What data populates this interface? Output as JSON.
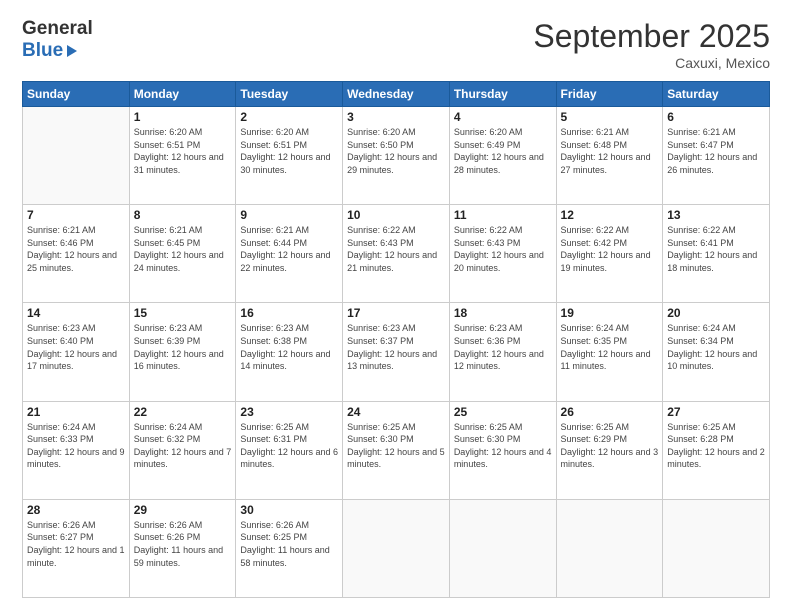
{
  "header": {
    "logo_line1": "General",
    "logo_line2": "Blue",
    "month_title": "September 2025",
    "subtitle": "Caxuxi, Mexico"
  },
  "calendar": {
    "days_of_week": [
      "Sunday",
      "Monday",
      "Tuesday",
      "Wednesday",
      "Thursday",
      "Friday",
      "Saturday"
    ],
    "weeks": [
      [
        {
          "day": "",
          "sunrise": "",
          "sunset": "",
          "daylight": ""
        },
        {
          "day": "1",
          "sunrise": "Sunrise: 6:20 AM",
          "sunset": "Sunset: 6:51 PM",
          "daylight": "Daylight: 12 hours and 31 minutes."
        },
        {
          "day": "2",
          "sunrise": "Sunrise: 6:20 AM",
          "sunset": "Sunset: 6:51 PM",
          "daylight": "Daylight: 12 hours and 30 minutes."
        },
        {
          "day": "3",
          "sunrise": "Sunrise: 6:20 AM",
          "sunset": "Sunset: 6:50 PM",
          "daylight": "Daylight: 12 hours and 29 minutes."
        },
        {
          "day": "4",
          "sunrise": "Sunrise: 6:20 AM",
          "sunset": "Sunset: 6:49 PM",
          "daylight": "Daylight: 12 hours and 28 minutes."
        },
        {
          "day": "5",
          "sunrise": "Sunrise: 6:21 AM",
          "sunset": "Sunset: 6:48 PM",
          "daylight": "Daylight: 12 hours and 27 minutes."
        },
        {
          "day": "6",
          "sunrise": "Sunrise: 6:21 AM",
          "sunset": "Sunset: 6:47 PM",
          "daylight": "Daylight: 12 hours and 26 minutes."
        }
      ],
      [
        {
          "day": "7",
          "sunrise": "Sunrise: 6:21 AM",
          "sunset": "Sunset: 6:46 PM",
          "daylight": "Daylight: 12 hours and 25 minutes."
        },
        {
          "day": "8",
          "sunrise": "Sunrise: 6:21 AM",
          "sunset": "Sunset: 6:45 PM",
          "daylight": "Daylight: 12 hours and 24 minutes."
        },
        {
          "day": "9",
          "sunrise": "Sunrise: 6:21 AM",
          "sunset": "Sunset: 6:44 PM",
          "daylight": "Daylight: 12 hours and 22 minutes."
        },
        {
          "day": "10",
          "sunrise": "Sunrise: 6:22 AM",
          "sunset": "Sunset: 6:43 PM",
          "daylight": "Daylight: 12 hours and 21 minutes."
        },
        {
          "day": "11",
          "sunrise": "Sunrise: 6:22 AM",
          "sunset": "Sunset: 6:43 PM",
          "daylight": "Daylight: 12 hours and 20 minutes."
        },
        {
          "day": "12",
          "sunrise": "Sunrise: 6:22 AM",
          "sunset": "Sunset: 6:42 PM",
          "daylight": "Daylight: 12 hours and 19 minutes."
        },
        {
          "day": "13",
          "sunrise": "Sunrise: 6:22 AM",
          "sunset": "Sunset: 6:41 PM",
          "daylight": "Daylight: 12 hours and 18 minutes."
        }
      ],
      [
        {
          "day": "14",
          "sunrise": "Sunrise: 6:23 AM",
          "sunset": "Sunset: 6:40 PM",
          "daylight": "Daylight: 12 hours and 17 minutes."
        },
        {
          "day": "15",
          "sunrise": "Sunrise: 6:23 AM",
          "sunset": "Sunset: 6:39 PM",
          "daylight": "Daylight: 12 hours and 16 minutes."
        },
        {
          "day": "16",
          "sunrise": "Sunrise: 6:23 AM",
          "sunset": "Sunset: 6:38 PM",
          "daylight": "Daylight: 12 hours and 14 minutes."
        },
        {
          "day": "17",
          "sunrise": "Sunrise: 6:23 AM",
          "sunset": "Sunset: 6:37 PM",
          "daylight": "Daylight: 12 hours and 13 minutes."
        },
        {
          "day": "18",
          "sunrise": "Sunrise: 6:23 AM",
          "sunset": "Sunset: 6:36 PM",
          "daylight": "Daylight: 12 hours and 12 minutes."
        },
        {
          "day": "19",
          "sunrise": "Sunrise: 6:24 AM",
          "sunset": "Sunset: 6:35 PM",
          "daylight": "Daylight: 12 hours and 11 minutes."
        },
        {
          "day": "20",
          "sunrise": "Sunrise: 6:24 AM",
          "sunset": "Sunset: 6:34 PM",
          "daylight": "Daylight: 12 hours and 10 minutes."
        }
      ],
      [
        {
          "day": "21",
          "sunrise": "Sunrise: 6:24 AM",
          "sunset": "Sunset: 6:33 PM",
          "daylight": "Daylight: 12 hours and 9 minutes."
        },
        {
          "day": "22",
          "sunrise": "Sunrise: 6:24 AM",
          "sunset": "Sunset: 6:32 PM",
          "daylight": "Daylight: 12 hours and 7 minutes."
        },
        {
          "day": "23",
          "sunrise": "Sunrise: 6:25 AM",
          "sunset": "Sunset: 6:31 PM",
          "daylight": "Daylight: 12 hours and 6 minutes."
        },
        {
          "day": "24",
          "sunrise": "Sunrise: 6:25 AM",
          "sunset": "Sunset: 6:30 PM",
          "daylight": "Daylight: 12 hours and 5 minutes."
        },
        {
          "day": "25",
          "sunrise": "Sunrise: 6:25 AM",
          "sunset": "Sunset: 6:30 PM",
          "daylight": "Daylight: 12 hours and 4 minutes."
        },
        {
          "day": "26",
          "sunrise": "Sunrise: 6:25 AM",
          "sunset": "Sunset: 6:29 PM",
          "daylight": "Daylight: 12 hours and 3 minutes."
        },
        {
          "day": "27",
          "sunrise": "Sunrise: 6:25 AM",
          "sunset": "Sunset: 6:28 PM",
          "daylight": "Daylight: 12 hours and 2 minutes."
        }
      ],
      [
        {
          "day": "28",
          "sunrise": "Sunrise: 6:26 AM",
          "sunset": "Sunset: 6:27 PM",
          "daylight": "Daylight: 12 hours and 1 minute."
        },
        {
          "day": "29",
          "sunrise": "Sunrise: 6:26 AM",
          "sunset": "Sunset: 6:26 PM",
          "daylight": "Daylight: 11 hours and 59 minutes."
        },
        {
          "day": "30",
          "sunrise": "Sunrise: 6:26 AM",
          "sunset": "Sunset: 6:25 PM",
          "daylight": "Daylight: 11 hours and 58 minutes."
        },
        {
          "day": "",
          "sunrise": "",
          "sunset": "",
          "daylight": ""
        },
        {
          "day": "",
          "sunrise": "",
          "sunset": "",
          "daylight": ""
        },
        {
          "day": "",
          "sunrise": "",
          "sunset": "",
          "daylight": ""
        },
        {
          "day": "",
          "sunrise": "",
          "sunset": "",
          "daylight": ""
        }
      ]
    ]
  }
}
